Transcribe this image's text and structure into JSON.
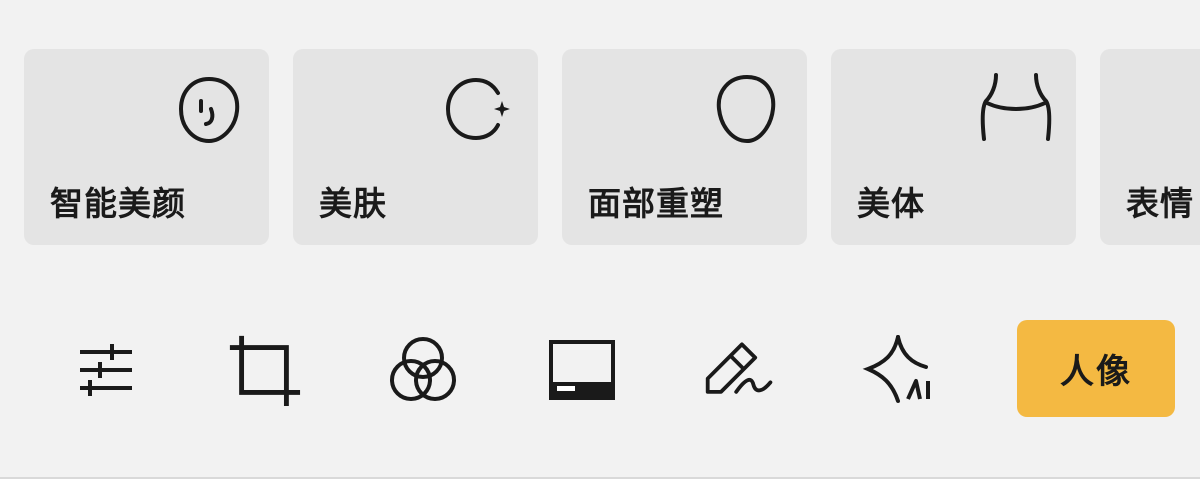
{
  "feature_cards": [
    {
      "label": "智能美颜",
      "icon": "face-smile-icon"
    },
    {
      "label": "美肤",
      "icon": "skin-sparkle-icon"
    },
    {
      "label": "面部重塑",
      "icon": "face-outline-icon"
    },
    {
      "label": "美体",
      "icon": "body-waist-icon"
    },
    {
      "label": "表情",
      "icon": "expression-icon"
    }
  ],
  "toolbar": {
    "tools": [
      {
        "name": "adjust-sliders-icon"
      },
      {
        "name": "crop-icon"
      },
      {
        "name": "filters-circles-icon"
      },
      {
        "name": "frame-border-icon"
      },
      {
        "name": "pencil-draw-icon"
      },
      {
        "name": "ai-magic-icon"
      }
    ],
    "portrait_label": "人像"
  },
  "colors": {
    "background": "#f2f2f2",
    "card": "#e4e4e4",
    "accent": "#f4b942",
    "ink": "#1a1a1a"
  }
}
